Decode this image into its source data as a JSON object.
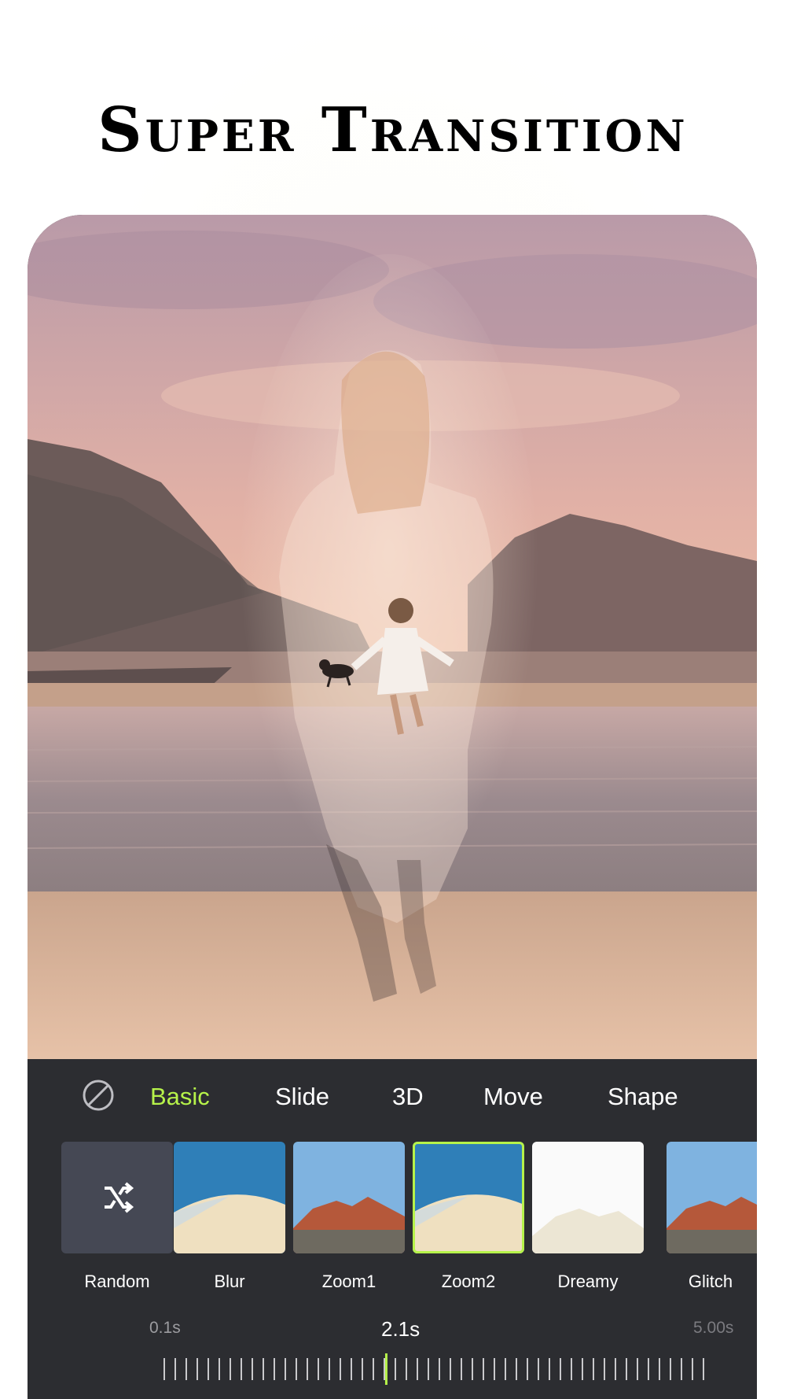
{
  "headline": "Super Transition",
  "transition_tabs": [
    {
      "label": "Basic",
      "active": true
    },
    {
      "label": "Slide",
      "active": false
    },
    {
      "label": "3D",
      "active": false
    },
    {
      "label": "Move",
      "active": false
    },
    {
      "label": "Shape",
      "active": false
    }
  ],
  "transitions": [
    {
      "label": "Random",
      "icon": "shuffle-icon",
      "selected": false
    },
    {
      "label": "Blur",
      "selected": false
    },
    {
      "label": "Zoom1",
      "selected": false
    },
    {
      "label": "Zoom2",
      "selected": true
    },
    {
      "label": "Dreamy",
      "selected": false
    },
    {
      "label": "Glitch",
      "selected": false
    }
  ],
  "duration": {
    "min_label": "0.1s",
    "current_label": "2.1s",
    "max_label": "5.00s",
    "min": 0.1,
    "max": 5.0,
    "value": 2.1
  },
  "colors": {
    "accent": "#b6f24a",
    "panel_bg": "#2c2d31",
    "text": "#ffffff"
  }
}
